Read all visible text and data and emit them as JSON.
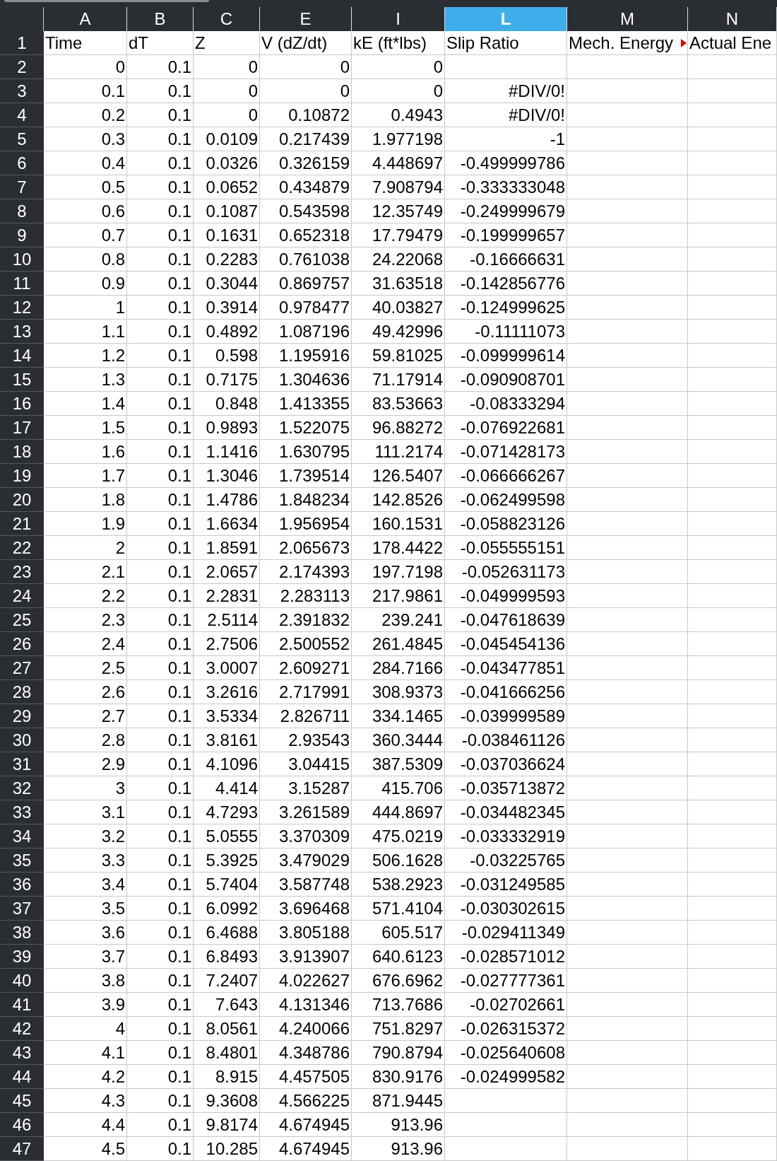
{
  "columns": [
    {
      "label": "A",
      "selected": false
    },
    {
      "label": "B",
      "selected": false
    },
    {
      "label": "C",
      "selected": false
    },
    {
      "label": "E",
      "selected": false
    },
    {
      "label": "I",
      "selected": false
    },
    {
      "label": "L",
      "selected": true
    },
    {
      "label": "M",
      "selected": false
    },
    {
      "label": "N",
      "selected": false
    }
  ],
  "header_row": {
    "number": "1",
    "cells": [
      {
        "text": "Time",
        "clipped": false
      },
      {
        "text": "dT",
        "clipped": false
      },
      {
        "text": "Z",
        "clipped": false
      },
      {
        "text": "V (dZ/dt)",
        "clipped": false
      },
      {
        "text": "kE (ft*lbs)",
        "clipped": false
      },
      {
        "text": "Slip Ratio",
        "clipped": false
      },
      {
        "text": "Mech. Energy",
        "clipped": true
      },
      {
        "text": "Actual Ene",
        "clipped": false
      }
    ]
  },
  "rows": [
    {
      "number": "2",
      "cells": [
        "0",
        "0.1",
        "0",
        "0",
        "0"
      ]
    },
    {
      "number": "3",
      "cells": [
        "0.1",
        "0.1",
        "0",
        "0",
        "0",
        "#DIV/0!"
      ]
    },
    {
      "number": "4",
      "cells": [
        "0.2",
        "0.1",
        "0",
        "0.10872",
        "0.4943",
        "#DIV/0!"
      ]
    },
    {
      "number": "5",
      "cells": [
        "0.3",
        "0.1",
        "0.0109",
        "0.217439",
        "1.977198",
        "-1"
      ]
    },
    {
      "number": "6",
      "cells": [
        "0.4",
        "0.1",
        "0.0326",
        "0.326159",
        "4.448697",
        "-0.499999786"
      ]
    },
    {
      "number": "7",
      "cells": [
        "0.5",
        "0.1",
        "0.0652",
        "0.434879",
        "7.908794",
        "-0.333333048"
      ]
    },
    {
      "number": "8",
      "cells": [
        "0.6",
        "0.1",
        "0.1087",
        "0.543598",
        "12.35749",
        "-0.249999679"
      ]
    },
    {
      "number": "9",
      "cells": [
        "0.7",
        "0.1",
        "0.1631",
        "0.652318",
        "17.79479",
        "-0.199999657"
      ]
    },
    {
      "number": "10",
      "cells": [
        "0.8",
        "0.1",
        "0.2283",
        "0.761038",
        "24.22068",
        "-0.16666631"
      ]
    },
    {
      "number": "11",
      "cells": [
        "0.9",
        "0.1",
        "0.3044",
        "0.869757",
        "31.63518",
        "-0.142856776"
      ]
    },
    {
      "number": "12",
      "cells": [
        "1",
        "0.1",
        "0.3914",
        "0.978477",
        "40.03827",
        "-0.124999625"
      ]
    },
    {
      "number": "13",
      "cells": [
        "1.1",
        "0.1",
        "0.4892",
        "1.087196",
        "49.42996",
        "-0.11111073"
      ]
    },
    {
      "number": "14",
      "cells": [
        "1.2",
        "0.1",
        "0.598",
        "1.195916",
        "59.81025",
        "-0.099999614"
      ]
    },
    {
      "number": "15",
      "cells": [
        "1.3",
        "0.1",
        "0.7175",
        "1.304636",
        "71.17914",
        "-0.090908701"
      ]
    },
    {
      "number": "16",
      "cells": [
        "1.4",
        "0.1",
        "0.848",
        "1.413355",
        "83.53663",
        "-0.08333294"
      ]
    },
    {
      "number": "17",
      "cells": [
        "1.5",
        "0.1",
        "0.9893",
        "1.522075",
        "96.88272",
        "-0.076922681"
      ]
    },
    {
      "number": "18",
      "cells": [
        "1.6",
        "0.1",
        "1.1416",
        "1.630795",
        "111.2174",
        "-0.071428173"
      ]
    },
    {
      "number": "19",
      "cells": [
        "1.7",
        "0.1",
        "1.3046",
        "1.739514",
        "126.5407",
        "-0.066666267"
      ]
    },
    {
      "number": "20",
      "cells": [
        "1.8",
        "0.1",
        "1.4786",
        "1.848234",
        "142.8526",
        "-0.062499598"
      ]
    },
    {
      "number": "21",
      "cells": [
        "1.9",
        "0.1",
        "1.6634",
        "1.956954",
        "160.1531",
        "-0.058823126"
      ]
    },
    {
      "number": "22",
      "cells": [
        "2",
        "0.1",
        "1.8591",
        "2.065673",
        "178.4422",
        "-0.055555151"
      ]
    },
    {
      "number": "23",
      "cells": [
        "2.1",
        "0.1",
        "2.0657",
        "2.174393",
        "197.7198",
        "-0.052631173"
      ]
    },
    {
      "number": "24",
      "cells": [
        "2.2",
        "0.1",
        "2.2831",
        "2.283113",
        "217.9861",
        "-0.049999593"
      ]
    },
    {
      "number": "25",
      "cells": [
        "2.3",
        "0.1",
        "2.5114",
        "2.391832",
        "239.241",
        "-0.047618639"
      ]
    },
    {
      "number": "26",
      "cells": [
        "2.4",
        "0.1",
        "2.7506",
        "2.500552",
        "261.4845",
        "-0.045454136"
      ]
    },
    {
      "number": "27",
      "cells": [
        "2.5",
        "0.1",
        "3.0007",
        "2.609271",
        "284.7166",
        "-0.043477851"
      ]
    },
    {
      "number": "28",
      "cells": [
        "2.6",
        "0.1",
        "3.2616",
        "2.717991",
        "308.9373",
        "-0.041666256"
      ]
    },
    {
      "number": "29",
      "cells": [
        "2.7",
        "0.1",
        "3.5334",
        "2.826711",
        "334.1465",
        "-0.039999589"
      ]
    },
    {
      "number": "30",
      "cells": [
        "2.8",
        "0.1",
        "3.8161",
        "2.93543",
        "360.3444",
        "-0.038461126"
      ]
    },
    {
      "number": "31",
      "cells": [
        "2.9",
        "0.1",
        "4.1096",
        "3.04415",
        "387.5309",
        "-0.037036624"
      ]
    },
    {
      "number": "32",
      "cells": [
        "3",
        "0.1",
        "4.414",
        "3.15287",
        "415.706",
        "-0.035713872"
      ]
    },
    {
      "number": "33",
      "cells": [
        "3.1",
        "0.1",
        "4.7293",
        "3.261589",
        "444.8697",
        "-0.034482345"
      ]
    },
    {
      "number": "34",
      "cells": [
        "3.2",
        "0.1",
        "5.0555",
        "3.370309",
        "475.0219",
        "-0.033332919"
      ]
    },
    {
      "number": "35",
      "cells": [
        "3.3",
        "0.1",
        "5.3925",
        "3.479029",
        "506.1628",
        "-0.03225765"
      ]
    },
    {
      "number": "36",
      "cells": [
        "3.4",
        "0.1",
        "5.7404",
        "3.587748",
        "538.2923",
        "-0.031249585"
      ]
    },
    {
      "number": "37",
      "cells": [
        "3.5",
        "0.1",
        "6.0992",
        "3.696468",
        "571.4104",
        "-0.030302615"
      ]
    },
    {
      "number": "38",
      "cells": [
        "3.6",
        "0.1",
        "6.4688",
        "3.805188",
        "605.517",
        "-0.029411349"
      ]
    },
    {
      "number": "39",
      "cells": [
        "3.7",
        "0.1",
        "6.8493",
        "3.913907",
        "640.6123",
        "-0.028571012"
      ]
    },
    {
      "number": "40",
      "cells": [
        "3.8",
        "0.1",
        "7.2407",
        "4.022627",
        "676.6962",
        "-0.027777361"
      ]
    },
    {
      "number": "41",
      "cells": [
        "3.9",
        "0.1",
        "7.643",
        "4.131346",
        "713.7686",
        "-0.02702661"
      ]
    },
    {
      "number": "42",
      "cells": [
        "4",
        "0.1",
        "8.0561",
        "4.240066",
        "751.8297",
        "-0.026315372"
      ]
    },
    {
      "number": "43",
      "cells": [
        "4.1",
        "0.1",
        "8.4801",
        "4.348786",
        "790.8794",
        "-0.025640608"
      ]
    },
    {
      "number": "44",
      "cells": [
        "4.2",
        "0.1",
        "8.915",
        "4.457505",
        "830.9176",
        "-0.024999582"
      ]
    },
    {
      "number": "45",
      "cells": [
        "4.3",
        "0.1",
        "9.3608",
        "4.566225",
        "871.9445"
      ]
    },
    {
      "number": "46",
      "cells": [
        "4.4",
        "0.1",
        "9.8174",
        "4.674945",
        "913.96"
      ]
    },
    {
      "number": "47",
      "cells": [
        "4.5",
        "0.1",
        "10.285",
        "4.674945",
        "913.96"
      ]
    }
  ]
}
